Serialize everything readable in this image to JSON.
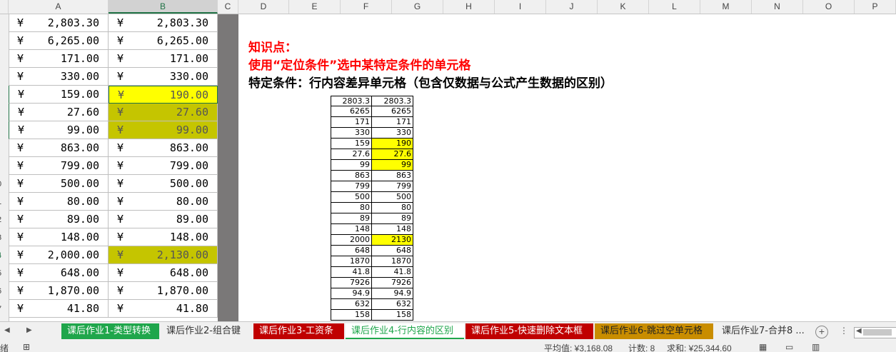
{
  "columns": [
    "A",
    "B",
    "C",
    "D",
    "E",
    "F",
    "G",
    "H",
    "I",
    "J",
    "K",
    "L",
    "M",
    "N",
    "O",
    "P"
  ],
  "row_numbers": [
    "",
    "",
    "",
    "",
    "",
    "",
    "",
    "",
    "",
    "0",
    "1",
    "2",
    "3",
    "4",
    "5",
    "6",
    "7"
  ],
  "sheet_rows": [
    {
      "a_cur": "¥",
      "a_val": "2,803.30",
      "b_cur": "¥",
      "b_val": "2,803.30",
      "b_fill": ""
    },
    {
      "a_cur": "¥",
      "a_val": "6,265.00",
      "b_cur": "¥",
      "b_val": "6,265.00",
      "b_fill": ""
    },
    {
      "a_cur": "¥",
      "a_val": "171.00",
      "b_cur": "¥",
      "b_val": "171.00",
      "b_fill": ""
    },
    {
      "a_cur": "¥",
      "a_val": "330.00",
      "b_cur": "¥",
      "b_val": "330.00",
      "b_fill": ""
    },
    {
      "a_cur": "¥",
      "a_val": "159.00",
      "b_cur": "¥",
      "b_val": "190.00",
      "b_fill": "#ffff00"
    },
    {
      "a_cur": "¥",
      "a_val": "27.60",
      "b_cur": "¥",
      "b_val": "27.60",
      "b_fill": "#c5c500"
    },
    {
      "a_cur": "¥",
      "a_val": "99.00",
      "b_cur": "¥",
      "b_val": "99.00",
      "b_fill": "#c5c500"
    },
    {
      "a_cur": "¥",
      "a_val": "863.00",
      "b_cur": "¥",
      "b_val": "863.00",
      "b_fill": ""
    },
    {
      "a_cur": "¥",
      "a_val": "799.00",
      "b_cur": "¥",
      "b_val": "799.00",
      "b_fill": ""
    },
    {
      "a_cur": "¥",
      "a_val": "500.00",
      "b_cur": "¥",
      "b_val": "500.00",
      "b_fill": ""
    },
    {
      "a_cur": "¥",
      "a_val": "80.00",
      "b_cur": "¥",
      "b_val": "80.00",
      "b_fill": ""
    },
    {
      "a_cur": "¥",
      "a_val": "89.00",
      "b_cur": "¥",
      "b_val": "89.00",
      "b_fill": ""
    },
    {
      "a_cur": "¥",
      "a_val": "148.00",
      "b_cur": "¥",
      "b_val": "148.00",
      "b_fill": ""
    },
    {
      "a_cur": "¥",
      "a_val": "2,000.00",
      "b_cur": "¥",
      "b_val": "2,130.00",
      "b_fill": "#c5c500"
    },
    {
      "a_cur": "¥",
      "a_val": "648.00",
      "b_cur": "¥",
      "b_val": "648.00",
      "b_fill": ""
    },
    {
      "a_cur": "¥",
      "a_val": "1,870.00",
      "b_cur": "¥",
      "b_val": "1,870.00",
      "b_fill": ""
    },
    {
      "a_cur": "¥",
      "a_val": "41.80",
      "b_cur": "¥",
      "b_val": "41.80",
      "b_fill": ""
    }
  ],
  "notes": {
    "title": "知识点：",
    "line1": "使用“定位条件”选中某特定条件的单元格",
    "line2": "特定条件：行内容差异单元格（包含仅数据与公式产生数据的区别）",
    "title_color": "#ff0000",
    "line1_color": "#ff0000",
    "line2_color": "#000000"
  },
  "mini_table": [
    {
      "left": "2803.3",
      "right": "2803.3",
      "hl": false
    },
    {
      "left": "6265",
      "right": "6265",
      "hl": false
    },
    {
      "left": "171",
      "right": "171",
      "hl": false
    },
    {
      "left": "330",
      "right": "330",
      "hl": false
    },
    {
      "left": "159",
      "right": "190",
      "hl": true
    },
    {
      "left": "27.6",
      "right": "27.6",
      "hl": true
    },
    {
      "left": "99",
      "right": "99",
      "hl": true
    },
    {
      "left": "863",
      "right": "863",
      "hl": false
    },
    {
      "left": "799",
      "right": "799",
      "hl": false
    },
    {
      "left": "500",
      "right": "500",
      "hl": false
    },
    {
      "left": "80",
      "right": "80",
      "hl": false
    },
    {
      "left": "89",
      "right": "89",
      "hl": false
    },
    {
      "left": "148",
      "right": "148",
      "hl": false
    },
    {
      "left": "2000",
      "right": "2130",
      "hl": true
    },
    {
      "left": "648",
      "right": "648",
      "hl": false
    },
    {
      "left": "1870",
      "right": "1870",
      "hl": false
    },
    {
      "left": "41.8",
      "right": "41.8",
      "hl": false
    },
    {
      "left": "7926",
      "right": "7926",
      "hl": false
    },
    {
      "left": "94.9",
      "right": "94.9",
      "hl": false
    },
    {
      "left": "632",
      "right": "632",
      "hl": false
    },
    {
      "left": "158",
      "right": "158",
      "hl": false
    }
  ],
  "tabs": [
    {
      "label": "课后作业1-类型转换",
      "style": "g"
    },
    {
      "label": "课后作业2-组合键",
      "style": "p"
    },
    {
      "label": "课后作业3-工资条",
      "style": "r"
    },
    {
      "label": "课后作业4-行内容的区别",
      "style": "a"
    },
    {
      "label": "课后作业5-快速删除文本框",
      "style": "r2"
    },
    {
      "label": "课后作业6-跳过空单元格",
      "style": "o"
    },
    {
      "label": "课后作业7-合并8 ...",
      "style": "p"
    }
  ],
  "status": {
    "ready": "绪",
    "average": "平均值: ¥3,168.08",
    "count": "计数: 8",
    "sum": "求和: ¥25,344.60"
  }
}
